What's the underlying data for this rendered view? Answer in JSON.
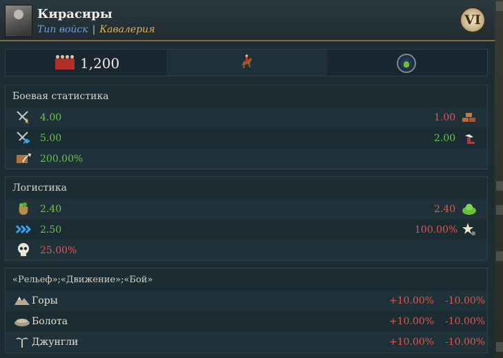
{
  "header": {
    "title": "Кирасиры",
    "type_label": "Тип войск",
    "separator": "|",
    "class_label": "Кавалерия",
    "rank": "VI"
  },
  "top_stats": {
    "manpower": "1,200"
  },
  "combat": {
    "title": "Боевая статистика",
    "rows": [
      {
        "left_value": "4.00",
        "right_value": "1.00"
      },
      {
        "left_value": "5.00",
        "right_value": "2.00"
      },
      {
        "left_value": "200.00%"
      }
    ]
  },
  "logistics": {
    "title": "Логистика",
    "rows": [
      {
        "left_value": "2.40",
        "right_value": "2.40"
      },
      {
        "left_value": "2.50",
        "right_value": "100.00%"
      },
      {
        "left_value": "25.00%"
      }
    ]
  },
  "terrain": {
    "title": "«Рельеф»;«Движение»;«Бой»",
    "rows": [
      {
        "name": "Горы",
        "movement": "+10.00%",
        "combat": "-10.00%"
      },
      {
        "name": "Болота",
        "movement": "+10.00%",
        "combat": "-10.00%"
      },
      {
        "name": "Джунгли",
        "movement": "+10.00%",
        "combat": "-10.00%"
      }
    ]
  },
  "colors": {
    "positive": "#6dc24a",
    "negative": "#e0574c",
    "border_gold": "#8a6a3a"
  }
}
